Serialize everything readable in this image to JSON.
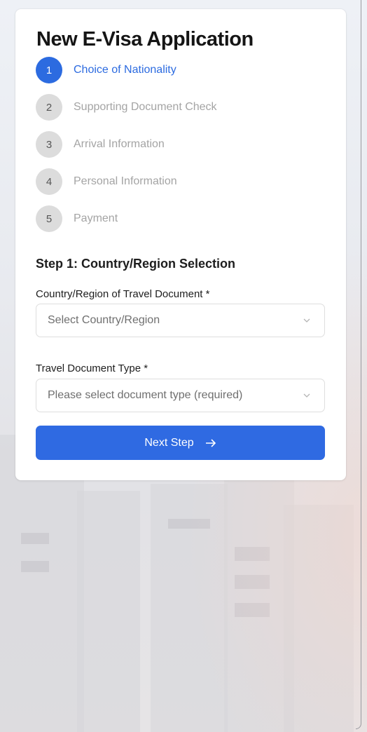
{
  "form": {
    "title": "New E-Visa Application",
    "steps": [
      {
        "number": "1",
        "label": "Choice of Nationality",
        "active": true
      },
      {
        "number": "2",
        "label": "Supporting Document Check",
        "active": false
      },
      {
        "number": "3",
        "label": "Arrival Information",
        "active": false
      },
      {
        "number": "4",
        "label": "Personal Information",
        "active": false
      },
      {
        "number": "5",
        "label": "Payment",
        "active": false
      }
    ],
    "section_title": "Step 1: Country/Region Selection",
    "country_field": {
      "label": "Country/Region of Travel Document *",
      "placeholder": "Select Country/Region"
    },
    "document_type_field": {
      "label": "Travel Document Type *",
      "placeholder": "Please select document type (required)"
    },
    "next_button": {
      "label": "Next Step",
      "icon": "arrow-right-icon"
    }
  },
  "colors": {
    "accent": "#2c6be0",
    "inactive_step": "#a4a4a4",
    "inactive_circle": "#dcdcdc",
    "card": "#ffffff"
  }
}
